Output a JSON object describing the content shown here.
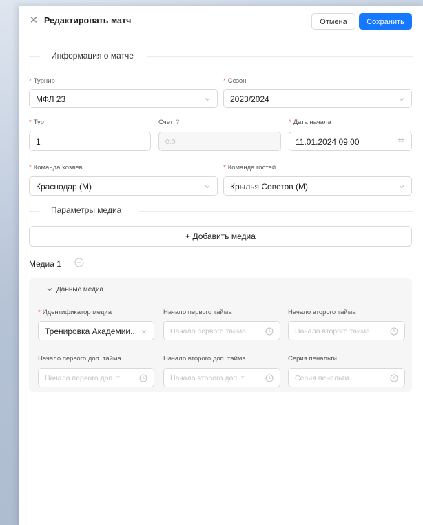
{
  "header": {
    "title": "Редактировать матч",
    "cancel_label": "Отмена",
    "save_label": "Сохранить"
  },
  "match_info": {
    "section_title": "Информация о матче",
    "tournament": {
      "label": "Турнир",
      "value": "МФЛ 23"
    },
    "season": {
      "label": "Сезон",
      "value": "2023/2024"
    },
    "round": {
      "label": "Тур",
      "value": "1"
    },
    "score": {
      "label": "Счет",
      "help": "?",
      "placeholder": "0:0"
    },
    "start_date": {
      "label": "Дата начала",
      "value": "11.01.2024 09:00"
    },
    "home_team": {
      "label": "Команда хозяев",
      "value": "Краснодар (М)"
    },
    "away_team": {
      "label": "Команда гостей",
      "value": "Крылья Советов (М)"
    }
  },
  "media_params": {
    "section_title": "Параметры медиа",
    "add_media_label": "+ Добавить медиа",
    "media_title": "Медиа 1",
    "collapse_title": "Данные медиа",
    "media_id": {
      "label": "Идентификатор медиа",
      "value": "Тренировка Академии..."
    },
    "first_half": {
      "label": "Начало первого тайма",
      "placeholder": "Начало первого тайма"
    },
    "second_half": {
      "label": "Начало второго тайма",
      "placeholder": "Начало второго тайма"
    },
    "first_extra": {
      "label": "Начало первого доп. тайма",
      "placeholder": "Начало первого доп. т..."
    },
    "second_extra": {
      "label": "Начало второго доп. тайма",
      "placeholder": "Начало второго доп. т..."
    },
    "penalty": {
      "label": "Серия пенальти",
      "placeholder": "Серия пенальти"
    }
  },
  "colors": {
    "primary": "#1677ff",
    "required": "#ff4d4f",
    "border": "#d9d9d9",
    "media_bg": "#f6f6f6"
  }
}
